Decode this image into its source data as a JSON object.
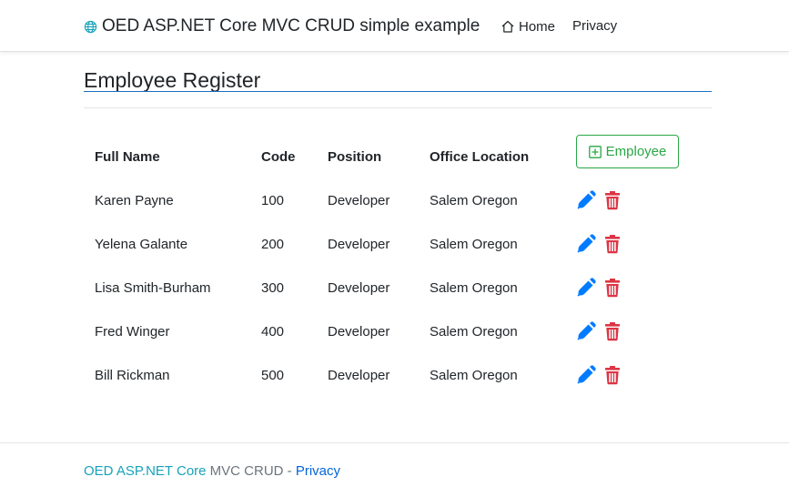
{
  "nav": {
    "brand": "OED ASP.NET Core MVC CRUD simple example",
    "home": "Home",
    "privacy": "Privacy"
  },
  "page": {
    "title": "Employee Register",
    "add_button": "Employee"
  },
  "table": {
    "headers": [
      "Full Name",
      "Code",
      "Position",
      "Office Location"
    ],
    "rows": [
      {
        "name": "Karen Payne",
        "code": "100",
        "position": "Developer",
        "location": "Salem Oregon"
      },
      {
        "name": "Yelena Galante",
        "code": "200",
        "position": "Developer",
        "location": "Salem Oregon"
      },
      {
        "name": "Lisa Smith-Burham",
        "code": "300",
        "position": "Developer",
        "location": "Salem Oregon"
      },
      {
        "name": "Fred Winger",
        "code": "400",
        "position": "Developer",
        "location": "Salem Oregon"
      },
      {
        "name": "Bill Rickman",
        "code": "500",
        "position": "Developer",
        "location": "Salem Oregon"
      }
    ]
  },
  "footer": {
    "brand_link": "OED ASP.NET Core",
    "text": " MVC CRUD - ",
    "privacy_link": "Privacy"
  },
  "icons": {
    "brand": "globe-icon",
    "home": "home-icon",
    "add": "plus-square-icon",
    "edit": "pen-icon",
    "delete": "trash-icon"
  },
  "colors": {
    "accent_blue": "#1b6ec2",
    "success_green": "#28a745",
    "edit_blue": "#007bff",
    "delete_red": "#dc3545",
    "footer_teal": "#17a2b8",
    "footer_link": "#0366d6"
  }
}
